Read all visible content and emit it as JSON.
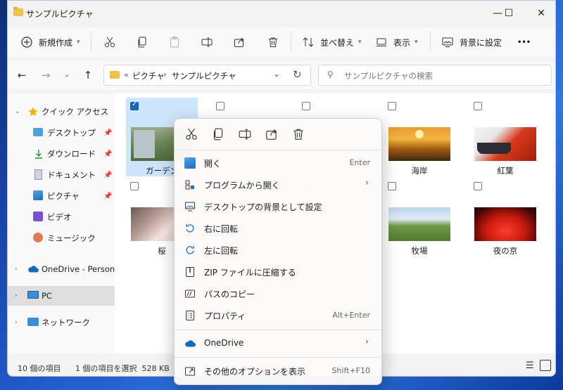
{
  "window": {
    "title": "サンプルピクチャ"
  },
  "titlebar_buttons": {
    "minimize": "—",
    "maximize": "☐",
    "close": "✕"
  },
  "toolbar": {
    "new_label": "新規作成",
    "sort_label": "並べ替え",
    "view_label": "表示",
    "set_background_label": "背景に設定",
    "more_label": "•••"
  },
  "address": {
    "overflow": "«",
    "segments": [
      "ピクチャ",
      "サンプルピクチャ"
    ],
    "separator": "›",
    "search_placeholder": "サンプルピクチャの検索"
  },
  "sidebar": {
    "items": [
      {
        "label": "クイック アクセス",
        "icon": "star-icon"
      },
      {
        "label": "デスクトップ",
        "icon": "desktop-icon",
        "pinned": true
      },
      {
        "label": "ダウンロード",
        "icon": "download-icon",
        "pinned": true
      },
      {
        "label": "ドキュメント",
        "icon": "document-icon",
        "pinned": true
      },
      {
        "label": "ピクチャ",
        "icon": "pictures-icon",
        "pinned": true
      },
      {
        "label": "ビデオ",
        "icon": "video-icon"
      },
      {
        "label": "ミュージック",
        "icon": "music-icon"
      },
      {
        "label": "OneDrive - Personal",
        "icon": "onedrive-icon"
      },
      {
        "label": "PC",
        "icon": "pc-icon"
      },
      {
        "label": "ネットワーク",
        "icon": "network-icon"
      }
    ]
  },
  "files": [
    {
      "name": "ガーデン",
      "selected": true
    },
    {
      "name": "",
      "selected": false
    },
    {
      "name": "",
      "selected": false
    },
    {
      "name": "海岸",
      "selected": false
    },
    {
      "name": "紅葉",
      "selected": false
    },
    {
      "name": "桜",
      "selected": false
    },
    {
      "name": "",
      "selected": false
    },
    {
      "name": "",
      "selected": false
    },
    {
      "name": "牧場",
      "selected": false
    },
    {
      "name": "夜の京",
      "selected": false
    }
  ],
  "status": {
    "item_count": "10 個の項目",
    "selection": "1 個の項目を選択  528 KB"
  },
  "context_menu": {
    "items": [
      {
        "label": "開く",
        "accel": "Enter",
        "icon": "image-icon"
      },
      {
        "label": "プログラムから開く",
        "accel": "",
        "icon": "open-with-icon",
        "submenu": true
      },
      {
        "label": "デスクトップの背景として設定",
        "accel": "",
        "icon": "wallpaper-icon"
      },
      {
        "label": "右に回転",
        "accel": "",
        "icon": "rotate-right-icon"
      },
      {
        "label": "左に回転",
        "accel": "",
        "icon": "rotate-left-icon"
      },
      {
        "label": "ZIP ファイルに圧縮する",
        "accel": "",
        "icon": "zip-icon"
      },
      {
        "label": "パスのコピー",
        "accel": "",
        "icon": "copy-path-icon"
      },
      {
        "label": "プロパティ",
        "accel": "Alt+Enter",
        "icon": "properties-icon"
      },
      {
        "label": "OneDrive",
        "accel": "",
        "icon": "onedrive-icon",
        "submenu": true
      },
      {
        "label": "その他のオプションを表示",
        "accel": "Shift+F10",
        "icon": "more-options-icon"
      }
    ],
    "submenu_arrow": "›"
  },
  "colors": {
    "accent": "#1565c0",
    "selection": "#cde5fb"
  }
}
